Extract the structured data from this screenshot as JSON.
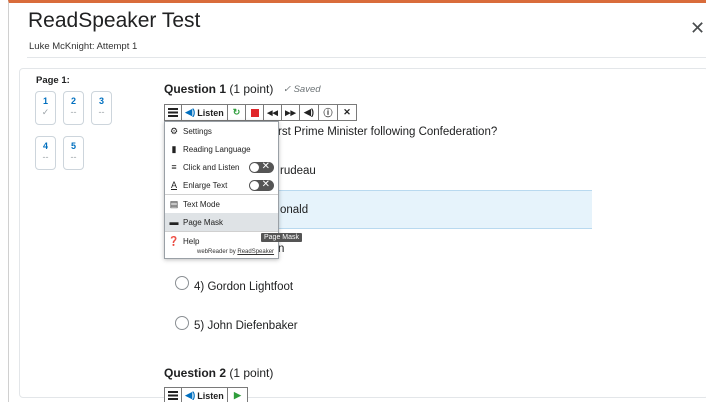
{
  "header": {
    "title": "ReadSpeaker Test",
    "subtitle": "Luke McKnight: Attempt 1",
    "close_glyph": "✕"
  },
  "sidebar": {
    "page_label": "Page 1:",
    "questions": [
      {
        "num": "1",
        "status": "✓"
      },
      {
        "num": "2",
        "status": "--"
      },
      {
        "num": "3",
        "status": "--"
      },
      {
        "num": "4",
        "status": "--"
      },
      {
        "num": "5",
        "status": "--"
      }
    ]
  },
  "question1": {
    "label": "Question 1",
    "points": "(1 point)",
    "saved": "✓ Saved",
    "text": "rst Prime Minister following Confederation?",
    "fragments": [
      "rudeau",
      "onald",
      "n"
    ],
    "answers": [
      {
        "num": "4)",
        "text": "Gordon Lightfoot"
      },
      {
        "num": "5)",
        "text": "John Diefenbaker"
      }
    ]
  },
  "question2": {
    "label": "Question 2",
    "points": "(1 point)"
  },
  "readspeaker": {
    "listen_label": "Listen",
    "menu": [
      {
        "label": "Settings",
        "icon": "gear-icon"
      },
      {
        "label": "Reading Language",
        "icon": "language-icon"
      },
      {
        "label": "Click and Listen",
        "icon": "click-listen-icon"
      },
      {
        "label": "Enlarge Text",
        "icon": "enlarge-text-icon"
      },
      {
        "label": "Text Mode",
        "icon": "text-mode-icon"
      },
      {
        "label": "Page Mask",
        "icon": "page-mask-icon"
      },
      {
        "label": "Help",
        "icon": "help-icon"
      }
    ],
    "footer_prefix": "webReader by ",
    "footer_link": "ReadSpeaker",
    "tooltip": "Page Mask"
  },
  "colors": {
    "accent_top": "#d96c3b",
    "link_blue": "#006fbf",
    "highlight": "#e6f3fb",
    "stop_red": "#e0262a",
    "play_green": "#2e9d3b"
  }
}
